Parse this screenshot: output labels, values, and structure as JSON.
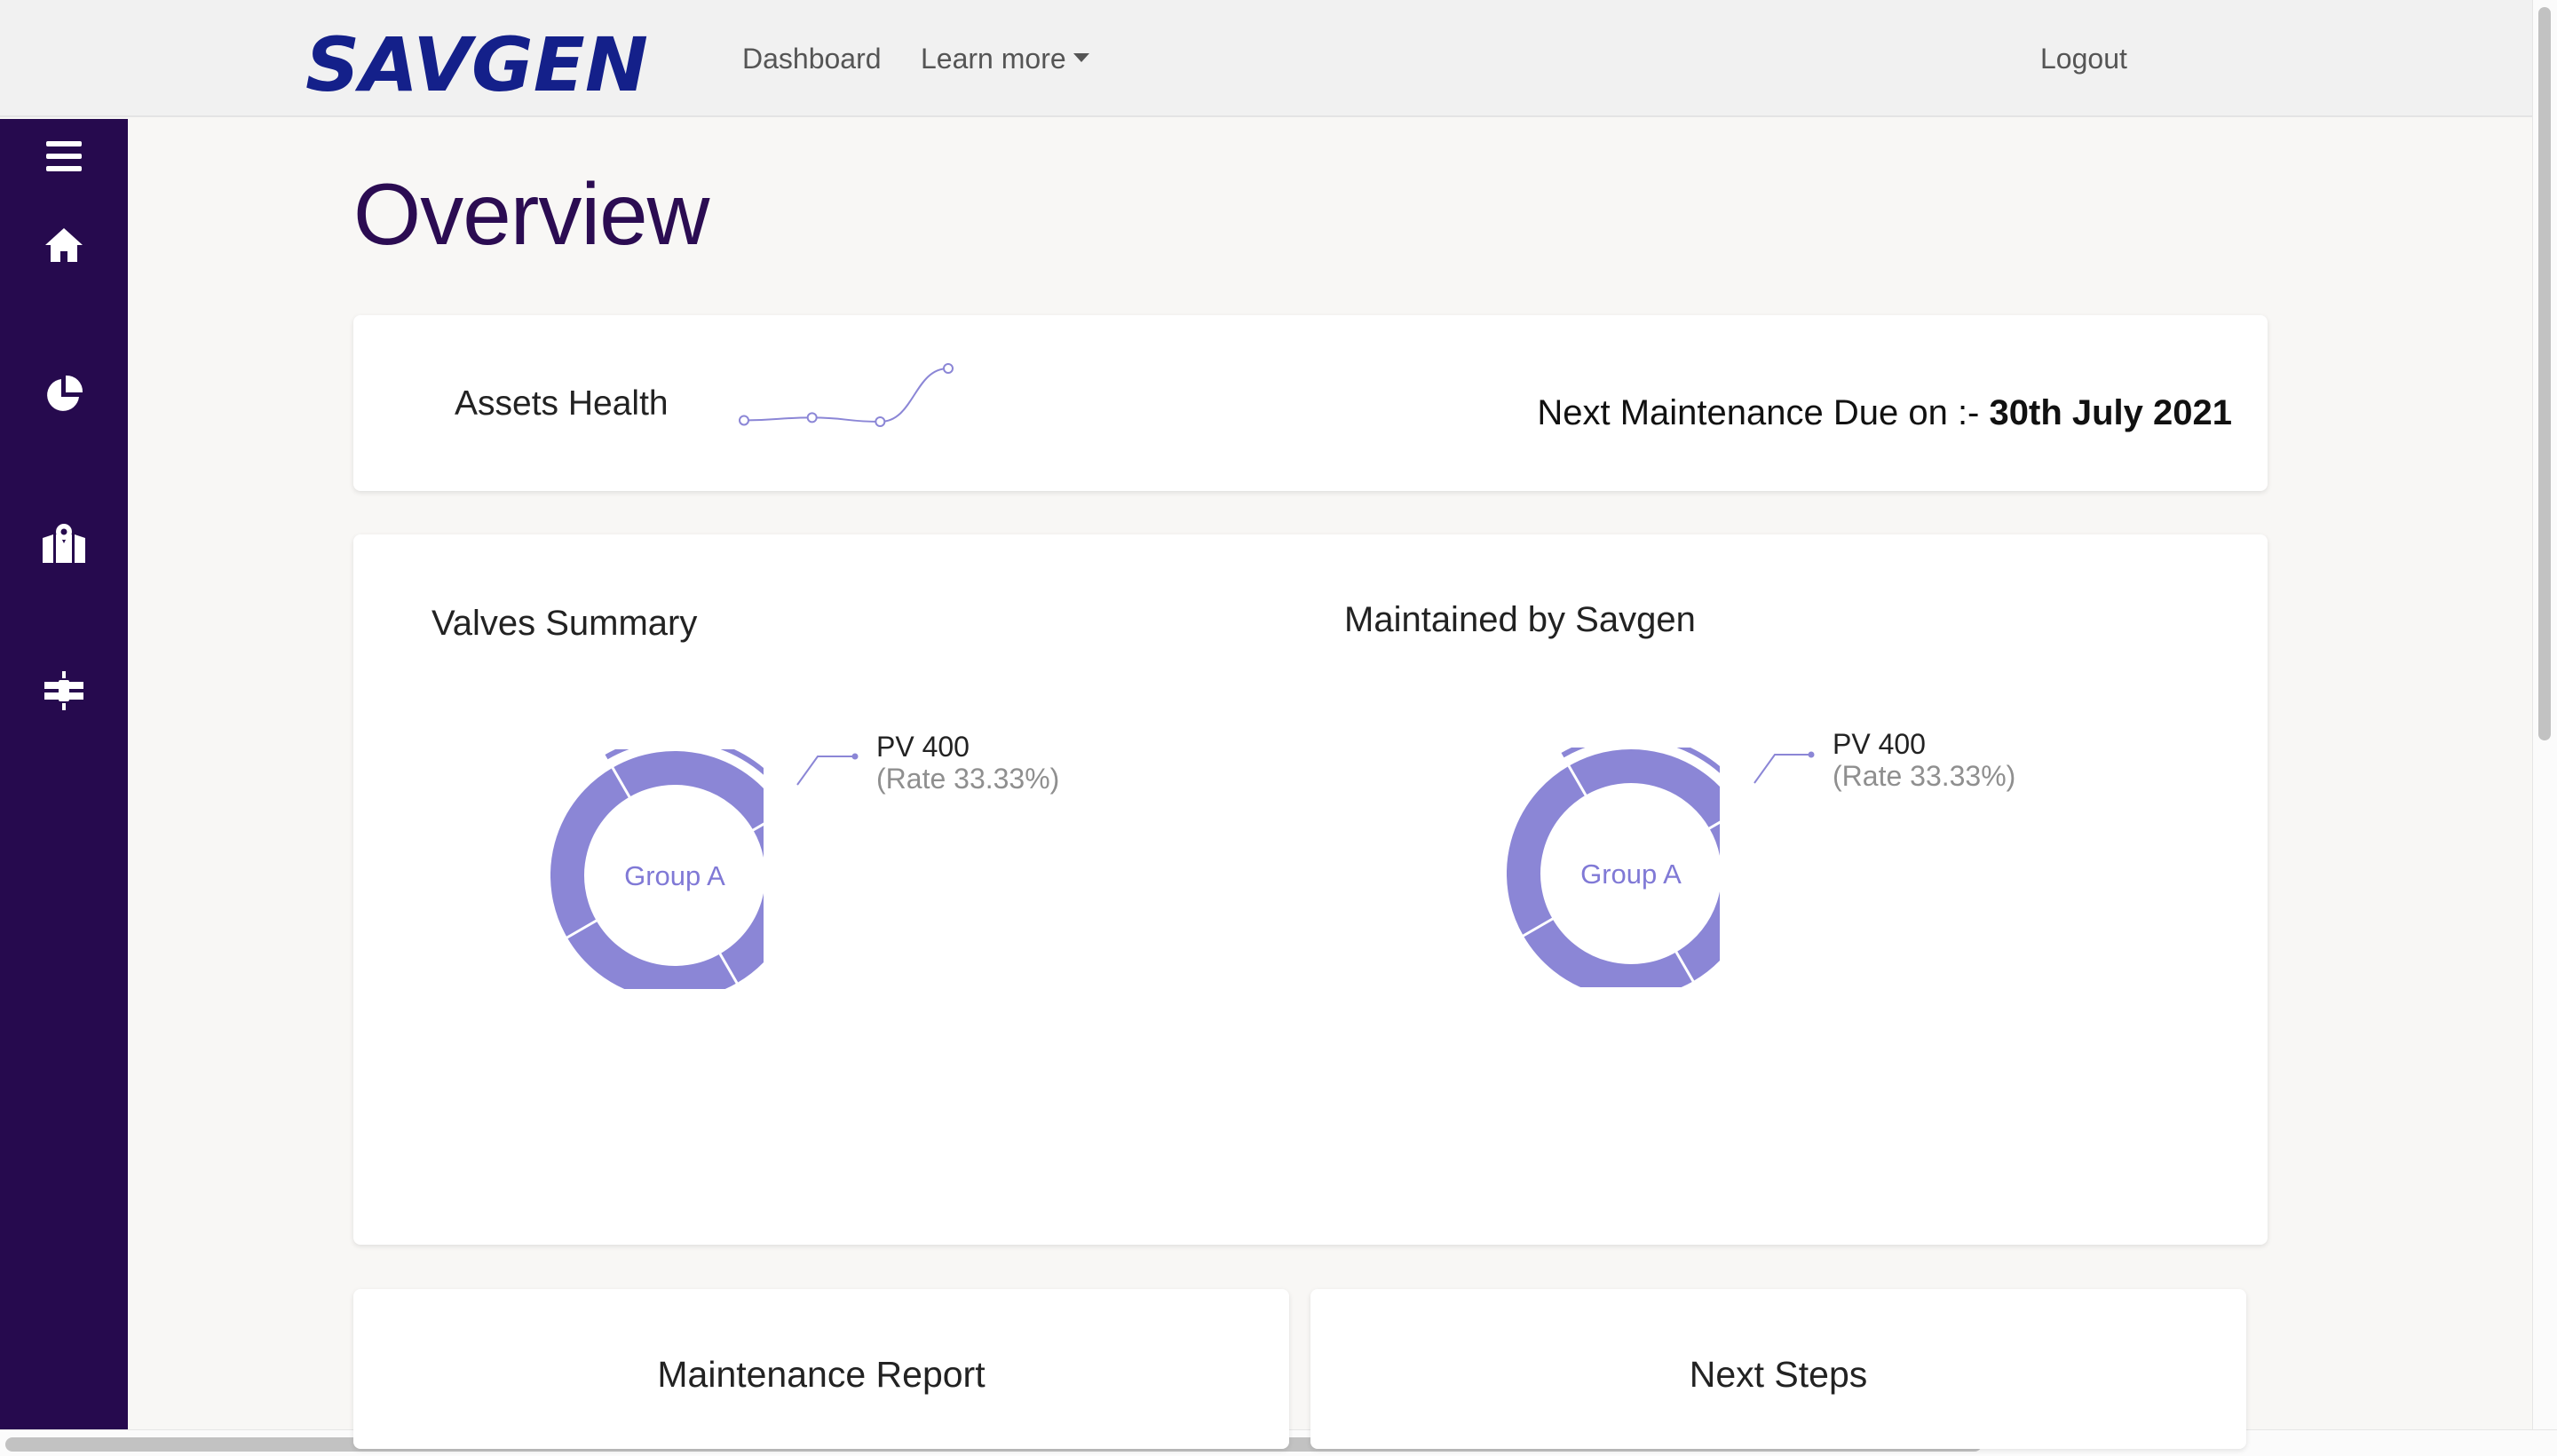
{
  "brand": {
    "logo_text": "SAVGEN",
    "color": "#14208a"
  },
  "navbar": {
    "dashboard_label": "Dashboard",
    "learn_more_label": "Learn more",
    "logout_label": "Logout"
  },
  "sidebar": {
    "icons": [
      "menu-icon",
      "home-icon",
      "pie-chart-icon",
      "map-icon",
      "satellite-icon"
    ]
  },
  "page": {
    "title": "Overview"
  },
  "assets_card": {
    "title": "Assets Health",
    "sparkline_values": [
      2,
      3,
      1.5,
      21
    ],
    "maintenance_prefix": "Next Maintenance Due on :- ",
    "maintenance_date": "30th July 2021"
  },
  "charts_card": {
    "left": {
      "title": "Valves Summary",
      "center_label": "Group A",
      "active_name": "PV 400",
      "active_rate": "(Rate 33.33%)"
    },
    "right": {
      "title": "Maintained by Savgen",
      "center_label": "Group A",
      "active_name": "PV 400",
      "active_rate": "(Rate 33.33%)"
    }
  },
  "chart_data": [
    {
      "type": "pie",
      "title": "Valves Summary",
      "center_label": "Group A",
      "values": [
        25,
        25,
        25,
        25
      ],
      "highlighted": {
        "name": "PV 400",
        "rate": "33.33%"
      }
    },
    {
      "type": "pie",
      "title": "Maintained by Savgen",
      "center_label": "Group A",
      "values": [
        25,
        25,
        25,
        25
      ],
      "highlighted": {
        "name": "PV 400",
        "rate": "33.33%"
      }
    }
  ],
  "bottom_cards": {
    "maintenance_report_title": "Maintenance Report",
    "next_steps_title": "Next Steps"
  },
  "colors": {
    "accent": "#8b86d6",
    "sidebar": "#260a4e",
    "title": "#2b0c52"
  }
}
